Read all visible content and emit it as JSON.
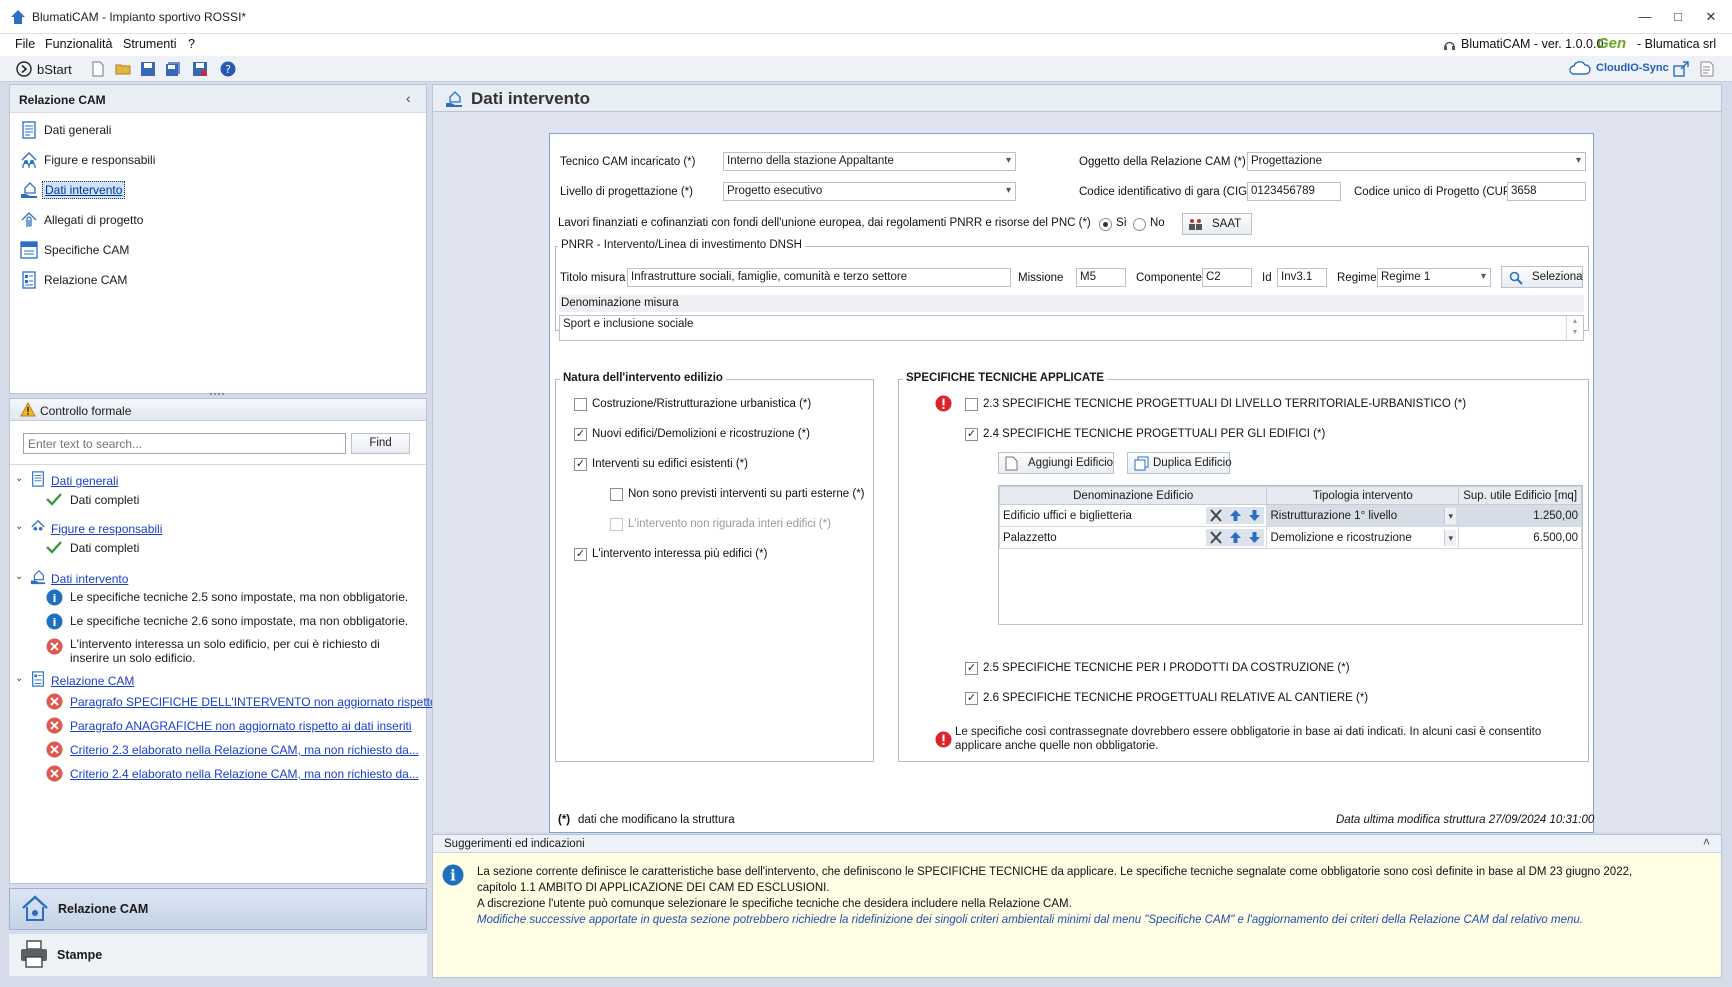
{
  "window": {
    "title": "BlumatiCAM - Impianto sportivo ROSSI*"
  },
  "menu": [
    "File",
    "Funzionalità",
    "Strumenti",
    "?"
  ],
  "version": {
    "label": "BlumatiCAM - ver. 1.0.0.0",
    "brand": "Gen",
    "company": "- Blumatica srl"
  },
  "toolbar": {
    "start_label": "bStart",
    "cloud_label": "CloudIO-Sync"
  },
  "nav": {
    "header": "Relazione CAM",
    "items": [
      {
        "label": "Dati generali",
        "icon": "document-icon"
      },
      {
        "label": "Figure e responsabili",
        "icon": "people-icon"
      },
      {
        "label": "Dati intervento",
        "icon": "hand-building-icon",
        "selected": true
      },
      {
        "label": "Allegati di progetto",
        "icon": "paperclip-icon"
      },
      {
        "label": "Specifiche CAM",
        "icon": "spec-icon"
      },
      {
        "label": "Relazione CAM",
        "icon": "report-icon"
      }
    ]
  },
  "controllo": {
    "header": "Controllo formale",
    "search_placeholder": "Enter text to search...",
    "find_label": "Find",
    "groups": [
      {
        "label": "Dati generali",
        "items": [
          {
            "type": "ok",
            "text": "Dati completi"
          }
        ]
      },
      {
        "label": "Figure e responsabili",
        "items": [
          {
            "type": "ok",
            "text": "Dati completi"
          }
        ]
      },
      {
        "label": "Dati intervento",
        "items": [
          {
            "type": "info",
            "text": "Le specifiche tecniche 2.5 sono impostate, ma non obbligatorie."
          },
          {
            "type": "info",
            "text": "Le specifiche tecniche 2.6 sono impostate, ma non obbligatorie."
          },
          {
            "type": "error",
            "text": "L'intervento interessa un solo edificio, per cui è richiesto di inserire un solo edificio."
          }
        ]
      },
      {
        "label": "Relazione CAM",
        "items": [
          {
            "type": "error-link",
            "text": "Paragrafo SPECIFICHE DELL'INTERVENTO non aggiornato rispetto ai da..."
          },
          {
            "type": "error-link",
            "text": "Paragrafo ANAGRAFICHE non aggiornato rispetto ai dati inseriti"
          },
          {
            "type": "error-link",
            "text": "Criterio 2.3 elaborato nella Relazione CAM, ma non richiesto da..."
          },
          {
            "type": "error-link",
            "text": "Criterio 2.4 elaborato nella Relazione CAM, ma non richiesto da..."
          }
        ]
      }
    ]
  },
  "bottom_nav": {
    "relazione": "Relazione CAM",
    "stampe": "Stampe"
  },
  "main": {
    "title": "Dati intervento",
    "tecnico_label": "Tecnico CAM incaricato (*)",
    "tecnico_value": "Interno della stazione Appaltante",
    "oggetto_label": "Oggetto della Relazione CAM (*)",
    "oggetto_value": "Progettazione",
    "livello_label": "Livello di progettazione (*)",
    "livello_value": "Progetto esecutivo",
    "cig_label": "Codice identificativo di gara (CIG)",
    "cig_value": "0123456789",
    "cup_label": "Codice unico di Progetto (CUP)",
    "cup_value": "3658",
    "pnrr_question": "Lavori finanziati e cofinanziati con fondi dell'unione europea, dai regolamenti PNRR e risorse del PNC (*)",
    "si_label": "Sì",
    "no_label": "No",
    "saat_label": "SAAT",
    "pnrr_group": "PNRR - Intervento/Linea di investimento DNSH",
    "titolo_label": "Titolo misura",
    "titolo_value": "Infrastrutture sociali, famiglie, comunità e terzo settore",
    "missione_label": "Missione",
    "missione_value": "M5",
    "componente_label": "Componente",
    "componente_value": "C2",
    "id_label": "Id",
    "id_value": "Inv3.1",
    "regime_label": "Regime",
    "regime_value": "Regime 1",
    "seleziona_label": "Seleziona",
    "denominazione_label": "Denominazione misura",
    "denominazione_value": "Sport e inclusione sociale",
    "natura_title": "Natura dell'intervento edilizio",
    "natura": [
      {
        "label": "Costruzione/Ristrutturazione urbanistica (*)",
        "checked": false
      },
      {
        "label": "Nuovi edifici/Demolizioni e ricostruzione (*)",
        "checked": true
      },
      {
        "label": "Interventi su edifici esistenti (*)",
        "checked": true
      },
      {
        "label": "Non sono previsti interventi su parti esterne (*)",
        "checked": false
      },
      {
        "label": "L'intervento non rigurada interi edifici (*)",
        "checked": false,
        "disabled": true
      },
      {
        "label": "L'intervento interessa più edifici (*)",
        "checked": true
      }
    ],
    "spec_title": "SPECIFICHE TECNICHE APPLICATE",
    "spec": [
      {
        "label": "2.3 SPECIFICHE TECNICHE PROGETTUALI DI LIVELLO TERRITORIALE-URBANISTICO (*)",
        "checked": false
      },
      {
        "label": "2.4 SPECIFICHE TECNICHE PROGETTUALI PER GLI EDIFICI (*)",
        "checked": true
      },
      {
        "label": "2.5 SPECIFICHE TECNICHE PER I PRODOTTI DA COSTRUZIONE (*)",
        "checked": true
      },
      {
        "label": "2.6 SPECIFICHE TECNICHE PROGETTUALI RELATIVE AL CANTIERE (*)",
        "checked": true
      }
    ],
    "aggiungi_label": "Aggiungi Edificio",
    "duplica_label": "Duplica Edificio",
    "table_headers": [
      "Denominazione Edificio",
      "Tipologia intervento",
      "Sup. utile Edificio [mq]"
    ],
    "table_rows": [
      {
        "nome": "Edificio uffici e biglietteria",
        "tipologia": "Ristrutturazione 1° livello",
        "sup": "1.250,00"
      },
      {
        "nome": "Palazzetto",
        "tipologia": "Demolizione e ricostruzione",
        "sup": "6.500,00"
      }
    ],
    "spec_note": "Le specifiche così contrassegnate dovrebbero essere obbligatorie in base ai dati indicati. In alcuni casi è consentito applicare anche quelle non obbligatorie.",
    "footer_left_mark": "(*)",
    "footer_left": "dati che modificano la struttura",
    "footer_right": "Data ultima modifica struttura 27/09/2024 10:31:00"
  },
  "suggestions": {
    "header": "Suggerimenti ed indicazioni",
    "line1": "La sezione corrente definisce le caratteristiche base dell'intervento, che definiscono le SPECIFICHE TECNICHE da applicare. Le specifiche tecniche segnalate come obbligatorie sono così definite in base  al DM 23 giugno 2022,",
    "line2": "capitolo 1.1 AMBITO DI APPLICAZIONE DEI CAM ED ESCLUSIONI.",
    "line3": "A discrezione l'utente può comunque selezionare le specifiche tecniche che desidera includere nella Relazione CAM.",
    "line4": "Modifiche  successive apportate in questa sezione potrebbero richiedre la ridefinizione dei singoli criteri ambientali minimi dal menu \"Specifiche CAM\" e l'aggiornamento dei criteri della Relazione CAM dal relativo menu."
  },
  "colors": {
    "accent": "#1f5fb5",
    "error": "#d9252b",
    "info": "#1f6fbf",
    "ok": "#3a9a3a"
  }
}
